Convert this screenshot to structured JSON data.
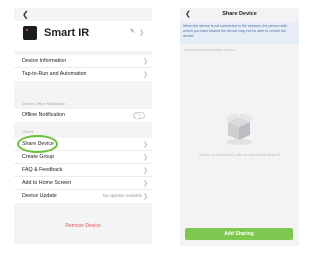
{
  "left": {
    "back_icon": "chevron-left-icon",
    "device_name": "Smart IR",
    "edit_icon": "pencil-icon",
    "group1": [
      {
        "label": "Device Information"
      },
      {
        "label": "Tap-to-Run and Automation"
      }
    ],
    "offline_section_title": "Device Offline Notification",
    "offline_notification": {
      "label": "Offline Notification",
      "enabled": false
    },
    "others_section_title": "Others",
    "group2": [
      {
        "label": "Share Device"
      },
      {
        "label": "Create Group"
      },
      {
        "label": "FAQ & Feedback"
      },
      {
        "label": "Add to Home Screen"
      },
      {
        "label": "Device Update",
        "value": "No updates available"
      }
    ],
    "remove_label": "Remove Device",
    "highlight_color": "#6cc13a"
  },
  "right": {
    "back_icon": "chevron-left-icon",
    "title": "Share Device",
    "notice_lines": [
      "When the device is not connected to the network, the person with",
      "whom you have shared the device may not be able to control the",
      "device."
    ],
    "shared_hint": "Share Devices has been shared",
    "empty_icon": "empty-box-icon",
    "empty_text": "Device is not shared, add an account to share it",
    "add_button": "Add Sharing",
    "accent_color": "#7ec850"
  }
}
